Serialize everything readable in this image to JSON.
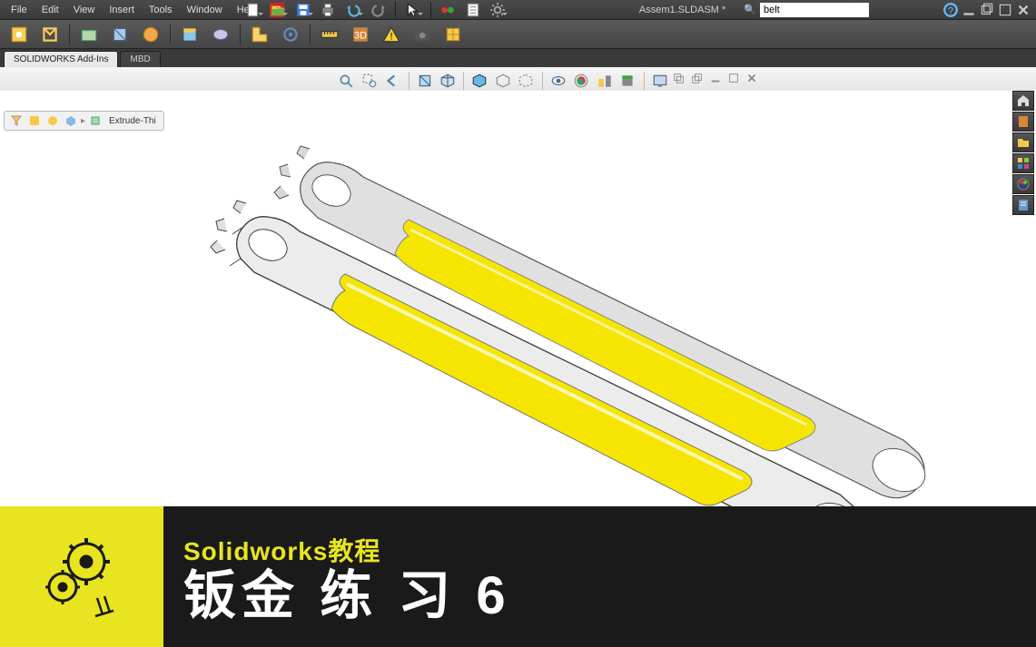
{
  "menu": {
    "items": [
      "File",
      "Edit",
      "View",
      "Insert",
      "Tools",
      "Window",
      "Help"
    ]
  },
  "docTitle": "Assem1.SLDASM *",
  "search": {
    "placeholder": "",
    "value": "belt"
  },
  "tabs": {
    "items": [
      "SOLIDWORKS Add-Ins",
      "MBD"
    ],
    "active": 0
  },
  "featureTree": {
    "label": "Extrude-Thi"
  },
  "banner": {
    "line1": "Solidworks教程",
    "line2": "钣金 练 习 6"
  },
  "icons": {
    "new": "new",
    "open": "open",
    "save": "save",
    "print": "print",
    "undo": "undo",
    "redo": "redo",
    "select": "select",
    "rebuild": "rebuild",
    "options": "options",
    "help": "help",
    "search": "search",
    "user": "user",
    "minimize": "min",
    "restore": "restore",
    "close": "close"
  }
}
